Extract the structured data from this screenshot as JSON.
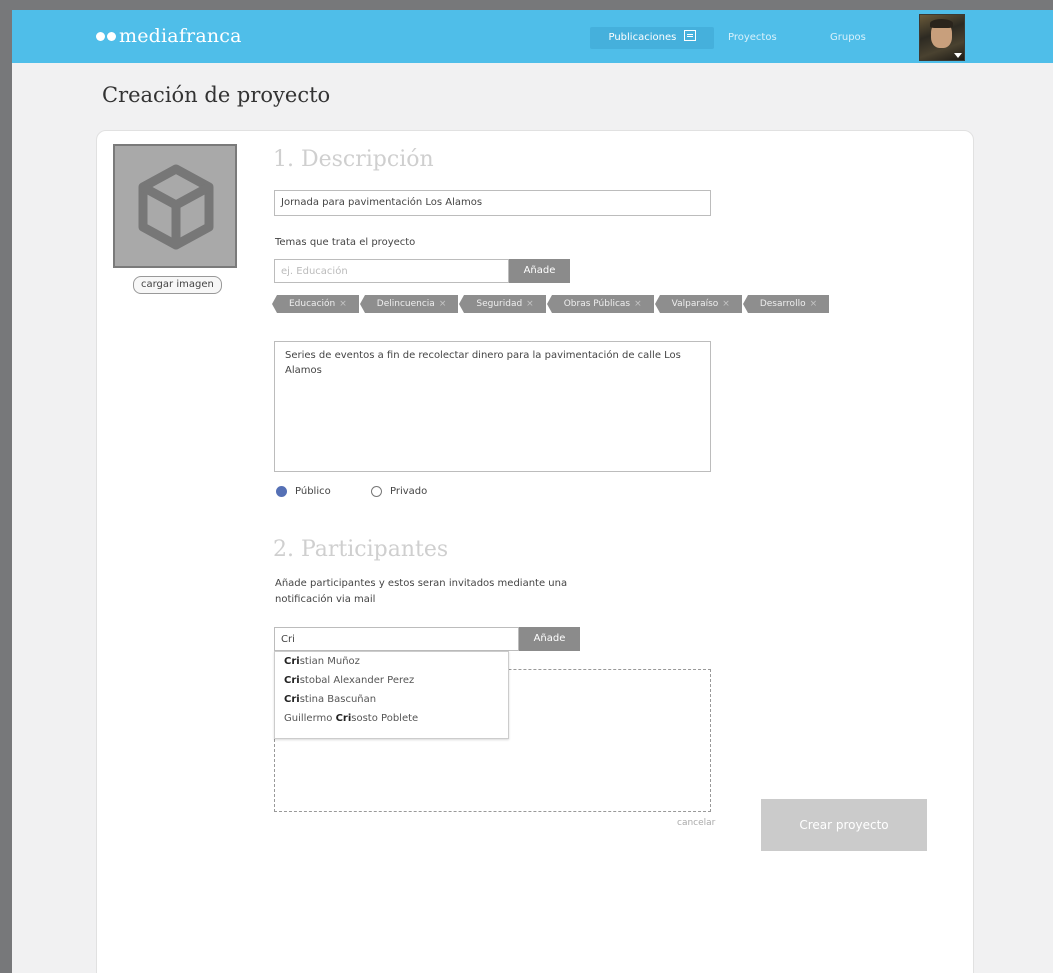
{
  "header": {
    "brand": "mediafranca",
    "nav": {
      "publicaciones": "Publicaciones",
      "proyectos": "Proyectos",
      "grupos": "Grupos"
    }
  },
  "page": {
    "title": "Creación de proyecto"
  },
  "image_upload": {
    "button_label": "cargar imagen"
  },
  "section1": {
    "title": "1. Descripción",
    "name_value": "Jornada para pavimentación Los Alamos",
    "topics_label": "Temas que trata el proyecto",
    "topics_placeholder": "ej. Educación",
    "add_label": "Añade",
    "tags": [
      "Educación",
      "Delincuencia",
      "Seguridad",
      "Obras Públicas",
      "Valparaíso",
      "Desarrollo"
    ],
    "tag_remove_glyph": "×",
    "description": "Series de eventos a fin de recolectar dinero para la pavimentación de calle Los Alamos",
    "visibility": {
      "public_label": "Público",
      "private_label": "Privado",
      "selected": "public"
    }
  },
  "section2": {
    "title": "2. Participantes",
    "help_line1": "Añade participantes y estos seran invitados mediante una",
    "help_line2": "notificación via mail",
    "search_value": "Cri",
    "add_label": "Añade",
    "suggestions": [
      {
        "pre": "",
        "match": "Cri",
        "post": "stian Muñoz"
      },
      {
        "pre": "",
        "match": "Cri",
        "post": "stobal Alexander Perez"
      },
      {
        "pre": "",
        "match": "Cri",
        "post": "stina Bascuñan"
      },
      {
        "pre": "Guillermo ",
        "match": "Cri",
        "post": "sosto Poblete"
      }
    ]
  },
  "actions": {
    "cancel_label": "cancelar",
    "create_label": "Crear proyecto"
  },
  "colors": {
    "topbar": "#4fbee9",
    "radio_selected": "#5570b5",
    "tag_bg": "#8e8e8e"
  }
}
